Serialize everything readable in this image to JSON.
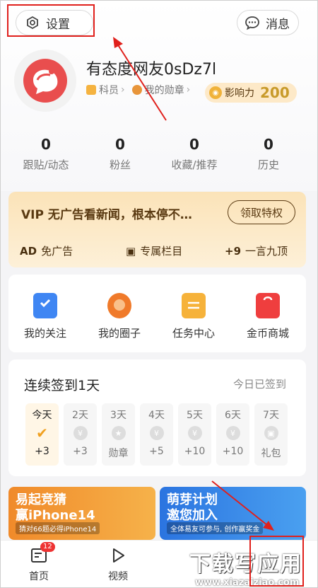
{
  "header": {
    "settings_label": "设置",
    "messages_label": "消息"
  },
  "profile": {
    "username": "有态度网友0sDz7l",
    "member_label": "科员",
    "medals_label": "我的勋章",
    "influence_label": "影响力",
    "influence_value": "200"
  },
  "stats": [
    {
      "value": "0",
      "label": "跟贴/动态"
    },
    {
      "value": "0",
      "label": "粉丝"
    },
    {
      "value": "0",
      "label": "收藏/推荐"
    },
    {
      "value": "0",
      "label": "历史"
    }
  ],
  "vip": {
    "title": "VIP 无广告看新闻，根本停不…",
    "button": "领取特权",
    "perks": [
      {
        "icon": "AD",
        "label": "免广告"
      },
      {
        "icon": "column-icon",
        "label": "专属栏目"
      },
      {
        "icon": "+9",
        "label": "一言九顶"
      }
    ]
  },
  "quick_grid": [
    {
      "label": "我的关注",
      "icon": "bookmark-icon",
      "color": "#3f86f3"
    },
    {
      "label": "我的圈子",
      "icon": "circle-chat-icon",
      "color": "#f07a2a"
    },
    {
      "label": "任务中心",
      "icon": "clipboard-icon",
      "color": "#f6b23a"
    },
    {
      "label": "金币商城",
      "icon": "shopping-bag-icon",
      "color": "#ef3e3e"
    }
  ],
  "sign_in": {
    "title": "连续签到1天",
    "status": "今日已签到",
    "days": [
      {
        "day": "今天",
        "reward": "+3",
        "icon": "✔"
      },
      {
        "day": "2天",
        "reward": "+3",
        "icon": "¥"
      },
      {
        "day": "3天",
        "reward": "勋章",
        "icon": "★"
      },
      {
        "day": "4天",
        "reward": "+5",
        "icon": "¥"
      },
      {
        "day": "5天",
        "reward": "+10",
        "icon": "¥"
      },
      {
        "day": "6天",
        "reward": "+10",
        "icon": "¥"
      },
      {
        "day": "7天",
        "reward": "礼包",
        "icon": "▣"
      }
    ]
  },
  "banners": [
    {
      "title": "易起竞猜\n赢iPhone14",
      "sub": "猜对66题必得iPhone14"
    },
    {
      "title": "萌芽计划\n邀您加入",
      "sub": "全体易友可参与, 创作赢奖金"
    }
  ],
  "bottom_nav": [
    {
      "label": "首页",
      "badge": "12"
    },
    {
      "label": "视频"
    }
  ],
  "watermark": {
    "main": "下载写应用",
    "url": "www.xiazaiziao.com"
  },
  "colors": {
    "accent_red": "#e0201c",
    "vip_brown": "#5a3a12",
    "influence_gold": "#c89a2a"
  }
}
